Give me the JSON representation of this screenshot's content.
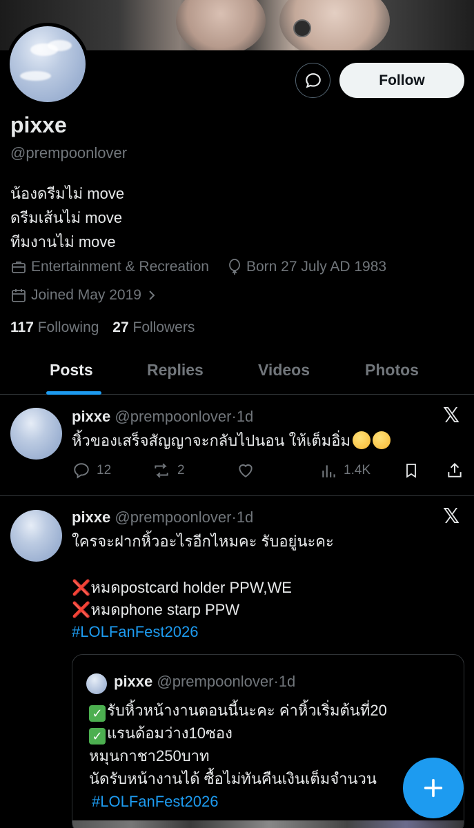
{
  "profile": {
    "display_name": "pixxe",
    "handle": "@prempoonlover",
    "bio_lines": [
      "น้องดรีมไม่ move",
      "ดรีมเส้นไม่ move",
      "ทีมงานไม่ move"
    ],
    "category": "Entertainment & Recreation",
    "born": "Born 27 July AD 1983",
    "joined": "Joined May 2019",
    "following_count": "117",
    "following_label": "Following",
    "followers_count": "27",
    "followers_label": "Followers"
  },
  "header_actions": {
    "follow_label": "Follow",
    "message_icon": "message-bubble-icon"
  },
  "tabs": [
    {
      "label": "Posts",
      "active": true
    },
    {
      "label": "Replies",
      "active": false
    },
    {
      "label": "Videos",
      "active": false
    },
    {
      "label": "Photos",
      "active": false
    }
  ],
  "posts": [
    {
      "name": "pixxe",
      "handle": "@prempoonlover",
      "sep": "·",
      "time": "1d",
      "text": "หิ้วของเสร็จสัญญาจะกลับไปนอน ให้เต็มอิ่ม",
      "replies": "12",
      "reposts": "2",
      "views": "1.4K"
    },
    {
      "name": "pixxe",
      "handle": "@prempoonlover",
      "sep": "·",
      "time": "1d",
      "line1": "ใครจะฝากหิ้วอะไรอีกไหมคะ รับอยู่นะคะ",
      "line2": "หมดpostcard holder PPW,WE",
      "line3": "หมดphone starp PPW",
      "hashtag": "#LOLFanFest2026",
      "quote": {
        "name": "pixxe",
        "handle": "@prempoonlover",
        "sep": "·",
        "time": "1d",
        "line1": "รับหิ้วหน้างานตอนนี้นะคะ ค่าหิ้วเริ่มต้นที่20",
        "line2": "แรนด้อมว่าง10ซอง",
        "line3": "หมุนกาชา250บาท",
        "line4": "นัดรับหน้างานได้ ซื้อไม่ทันคืนเงินเต็มจำนวน",
        "hashtag": "#LOLFanFest2026"
      }
    }
  ],
  "colors": {
    "accent": "#1d9bf0",
    "muted": "#71767b",
    "text": "#e7e9ea",
    "divider": "#2f3336"
  }
}
